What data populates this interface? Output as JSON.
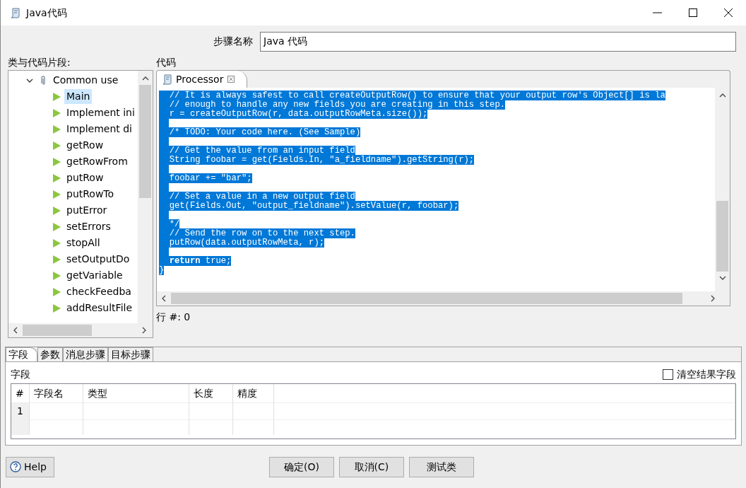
{
  "window": {
    "title": "Java代码"
  },
  "step_name": {
    "label": "步骤名称",
    "value": "Java 代码"
  },
  "snippets": {
    "label": "类与代码片段:",
    "tree": [
      {
        "label": "Common use",
        "expanded": true,
        "children": [
          {
            "label": "Main",
            "selected": true
          },
          {
            "label": "Implement ini",
            "selected": false
          },
          {
            "label": "Implement di",
            "selected": false
          },
          {
            "label": "getRow",
            "selected": false
          },
          {
            "label": "getRowFrom",
            "selected": false
          },
          {
            "label": "putRow",
            "selected": false
          },
          {
            "label": "putRowTo",
            "selected": false
          },
          {
            "label": "putError",
            "selected": false
          },
          {
            "label": "setErrors",
            "selected": false
          },
          {
            "label": "stopAll",
            "selected": false
          },
          {
            "label": "setOutputDo",
            "selected": false
          },
          {
            "label": "getVariable",
            "selected": false
          },
          {
            "label": "checkFeedba",
            "selected": false
          },
          {
            "label": "addResultFile",
            "selected": false
          }
        ]
      }
    ]
  },
  "code": {
    "label": "代码",
    "tabs": [
      {
        "label": "Processor",
        "selected": true
      }
    ],
    "selected": true,
    "lines": [
      {
        "kind": "code",
        "text": "  // It is always safest to call createOutputRow() to ensure that your output row's Object[] is la"
      },
      {
        "kind": "code",
        "text": "  // enough to handle any new fields you are creating in this step."
      },
      {
        "kind": "code",
        "text": "  r = createOutputRow(r, data.outputRowMeta.size());"
      },
      {
        "kind": "blank"
      },
      {
        "kind": "code",
        "text": "  /* TODO: Your code here. (See Sample)"
      },
      {
        "kind": "blank"
      },
      {
        "kind": "code",
        "text": "  // Get the value from an input field"
      },
      {
        "kind": "code",
        "text": "  String foobar = get(Fields.In, \"a_fieldname\").getString(r);"
      },
      {
        "kind": "blank"
      },
      {
        "kind": "code",
        "text": "  foobar += \"bar\";"
      },
      {
        "kind": "blank"
      },
      {
        "kind": "code",
        "text": "  // Set a value in a new output field"
      },
      {
        "kind": "code",
        "text": "  get(Fields.Out, \"output_fieldname\").setValue(r, foobar);"
      },
      {
        "kind": "blank"
      },
      {
        "kind": "code",
        "text": "  */"
      },
      {
        "kind": "code",
        "text": "  // Send the row on to the next step."
      },
      {
        "kind": "code",
        "text": "  putRow(data.outputRowMeta, r);"
      },
      {
        "kind": "blank"
      },
      {
        "kind": "code",
        "text": "  **return** true;"
      },
      {
        "kind": "code",
        "text": "}"
      }
    ],
    "row_status": "行 #: 0"
  },
  "bottom": {
    "tabs": [
      {
        "label": "字段",
        "selected": true
      },
      {
        "label": "参数",
        "selected": false
      },
      {
        "label": "消息步骤",
        "selected": false
      },
      {
        "label": "目标步骤",
        "selected": false
      }
    ],
    "section_label": "字段",
    "clear_results": {
      "label": "清空结果字段",
      "checked": false
    },
    "table": {
      "columns": [
        "#",
        "字段名",
        "类型",
        "长度",
        "精度"
      ],
      "rows": [
        {
          "index": "1"
        }
      ]
    }
  },
  "buttons": {
    "help": "Help",
    "actions": [
      "确定(O)",
      "取消(C)",
      "测试类"
    ]
  }
}
